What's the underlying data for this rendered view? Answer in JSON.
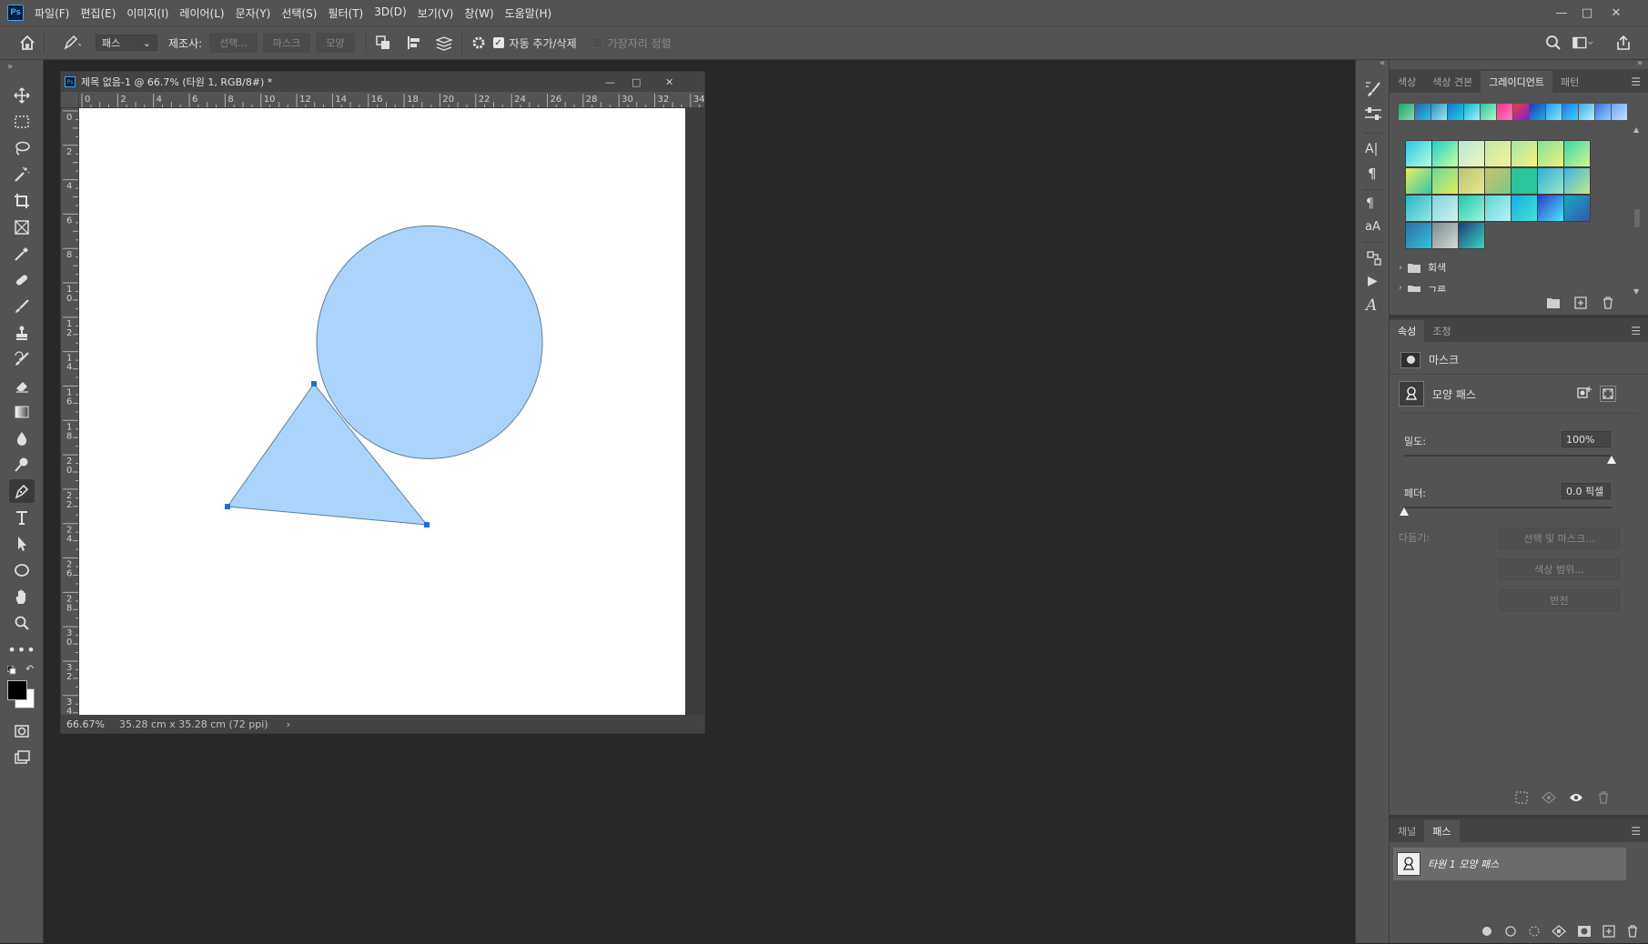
{
  "menubar": {
    "logo": "Ps",
    "items": [
      "파일(F)",
      "편집(E)",
      "이미지(I)",
      "레이어(L)",
      "문자(Y)",
      "선택(S)",
      "필터(T)",
      "3D(D)",
      "보기(V)",
      "창(W)",
      "도움말(H)"
    ]
  },
  "options": {
    "mode_value": "패스",
    "make_label": "제조사:",
    "select_btn": "선택...",
    "mask_btn": "마스크",
    "shape_btn": "모양",
    "auto_add_label": "자동 추가/삭제",
    "align_edges_label": "가장자리 정렬",
    "auto_add_checked": true,
    "align_edges_checked": false
  },
  "document": {
    "title": "제목 없음-1 @ 66.7% (타원 1, RGB/8#) *",
    "ruler_h": [
      "0",
      "2",
      "4",
      "6",
      "8",
      "10",
      "12",
      "14",
      "16",
      "18",
      "20",
      "22",
      "24",
      "26",
      "28",
      "30",
      "32",
      "34"
    ],
    "ruler_v": [
      "0",
      "2",
      "4",
      "6",
      "8",
      "1\n0",
      "1\n2",
      "1\n4",
      "1\n6",
      "1\n8",
      "2\n0",
      "2\n2",
      "2\n4",
      "2\n6",
      "2\n8",
      "3\n0",
      "3\n2",
      "3\n4"
    ],
    "zoom": "66.67%",
    "size_info": "35.28 cm x 35.28 cm (72 ppi)",
    "shape_fill": "#aad4fb"
  },
  "gradient_panel": {
    "tabs": [
      "색상",
      "색상 견본",
      "그레이디언트",
      "패턴"
    ],
    "active_tab": "그레이디언트",
    "folders": [
      "회색",
      "그룹"
    ]
  },
  "properties_panel": {
    "tabs": [
      "속성",
      "조정"
    ],
    "active_tab": "속성",
    "mask_label": "마스크",
    "shape_path_label": "모양 패스",
    "density_label": "밀도:",
    "density_value": "100%",
    "density_fraction": 1.0,
    "feather_label": "페더:",
    "feather_value": "0.0 픽셀",
    "feather_fraction": 0.0,
    "refine_label": "다듬기:",
    "select_mask_btn": "선택 및 마스크...",
    "color_range_btn": "색상 범위...",
    "invert_btn": "반전"
  },
  "paths_panel": {
    "tabs": [
      "채널",
      "패스"
    ],
    "active_tab": "패스",
    "path_item": "타원 1 모양 패스"
  }
}
